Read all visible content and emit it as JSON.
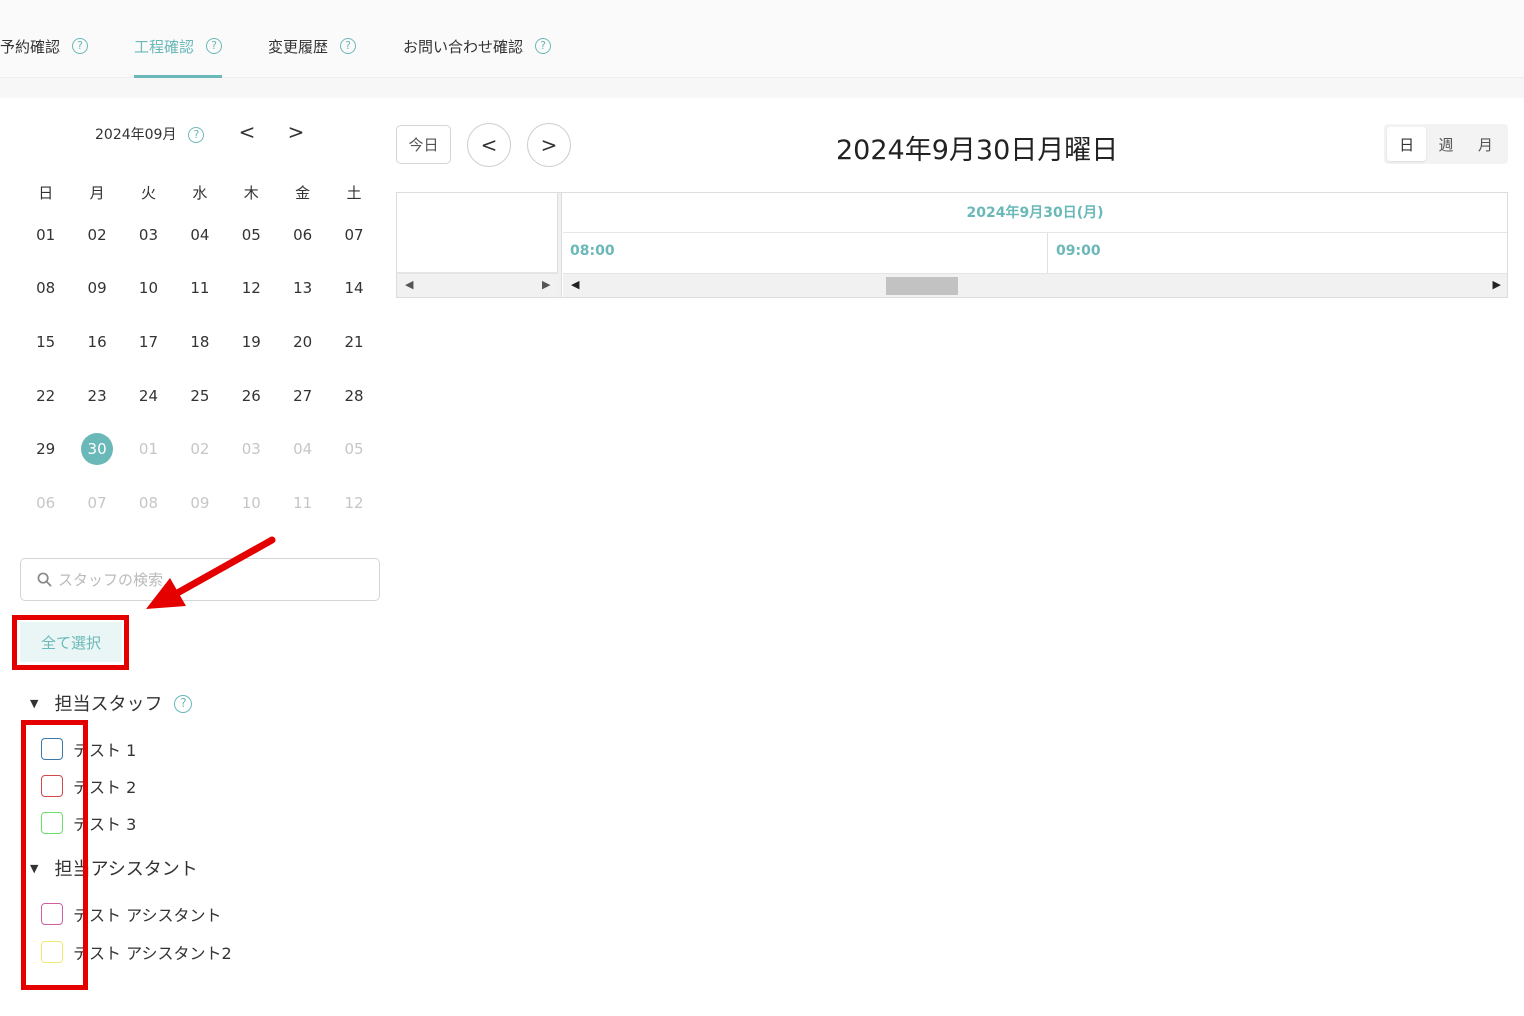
{
  "tabs": [
    {
      "label": "予約確認",
      "active": false
    },
    {
      "label": "工程確認",
      "active": true
    },
    {
      "label": "変更履歴",
      "active": false
    },
    {
      "label": "お問い合わせ確認",
      "active": false
    }
  ],
  "help_glyph": "?",
  "mini_calendar": {
    "month_label": "2024年09月",
    "prev_glyph": "<",
    "next_glyph": ">",
    "weekdays": [
      "日",
      "月",
      "火",
      "水",
      "木",
      "金",
      "土"
    ],
    "weeks": [
      [
        "01",
        "02",
        "03",
        "04",
        "05",
        "06",
        "07"
      ],
      [
        "08",
        "09",
        "10",
        "11",
        "12",
        "13",
        "14"
      ],
      [
        "15",
        "16",
        "17",
        "18",
        "19",
        "20",
        "21"
      ],
      [
        "22",
        "23",
        "24",
        "25",
        "26",
        "27",
        "28"
      ],
      [
        "29",
        "30",
        "01",
        "02",
        "03",
        "04",
        "05"
      ],
      [
        "06",
        "07",
        "08",
        "09",
        "10",
        "11",
        "12"
      ]
    ],
    "selected_day": "30"
  },
  "search": {
    "placeholder": "スタッフの検索"
  },
  "select_all_label": "全て選択",
  "staff_group": {
    "title": "担当スタッフ",
    "items": [
      {
        "label": "テスト 1",
        "color": "#3a78a8"
      },
      {
        "label": "テスト 2",
        "color": "#d04848"
      },
      {
        "label": "テスト 3",
        "color": "#6adf6a"
      }
    ]
  },
  "assistant_group": {
    "title": "担当アシスタント",
    "items": [
      {
        "label": "テスト アシスタント",
        "color": "#d060a0"
      },
      {
        "label": "テスト アシスタント2",
        "color": "#f0e870"
      }
    ]
  },
  "scheduler": {
    "today_label": "今日",
    "prev_glyph": "<",
    "next_glyph": ">",
    "title": "2024年9月30日月曜日",
    "views": [
      {
        "label": "日",
        "active": true
      },
      {
        "label": "週",
        "active": false
      },
      {
        "label": "月",
        "active": false
      }
    ],
    "date_header": "2024年9月30日(月)",
    "hours": [
      "08:00",
      "09:00"
    ]
  },
  "colors": {
    "accent": "#6ab8b8",
    "annotation": "#e50000"
  }
}
